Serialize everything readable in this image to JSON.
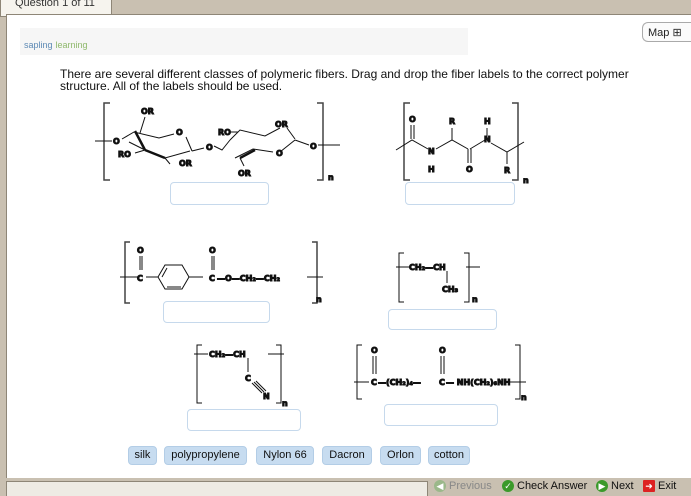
{
  "tab": "Question 1 of 11",
  "logo": {
    "part1": "sapling",
    "part2": "learning"
  },
  "map_label": "Map",
  "prompt": "There are several different classes of polymeric fibers. Drag and drop the fiber labels to the correct polymer structure. All of the labels should be used.",
  "structures": {
    "cellulose": {
      "or1": "OR",
      "o_ring1": "O",
      "ro1": "RO",
      "or2": "OR",
      "o_left": "O",
      "o_link": "O",
      "ro2": "RO",
      "or3": "OR",
      "o_ring2": "O",
      "or4": "OR",
      "o_right": "O",
      "n": "n"
    },
    "protein": {
      "o1": "O",
      "n1": "N",
      "h1": "H",
      "r1": "R",
      "o2": "O",
      "h2": "H",
      "n2": "N",
      "r2": "R",
      "n": "n"
    },
    "pet": {
      "o1": "O",
      "c1": "C",
      "o2": "O",
      "c2": "C",
      "chain": "—O—CH₂—CH₂",
      "n": "n"
    },
    "pp": {
      "chain": "CH₂—CH",
      "ch3": "CH₃",
      "n": "n"
    },
    "orlon": {
      "chain": "CH₂—CH",
      "c": "C",
      "nn": "N",
      "n": "n"
    },
    "nylon": {
      "o1": "O",
      "c1": "C",
      "mid": "—(CH₂)₄—",
      "o2": "O",
      "c2": "C",
      "tail": "— NH(CH₂)₆NH",
      "n": "n"
    }
  },
  "labels": [
    "silk",
    "polypropylene",
    "Nylon 66",
    "Dacron",
    "Orlon",
    "cotton"
  ],
  "nav": {
    "previous": "Previous",
    "check": "Check Answer",
    "next": "Next",
    "exit": "Exit"
  }
}
